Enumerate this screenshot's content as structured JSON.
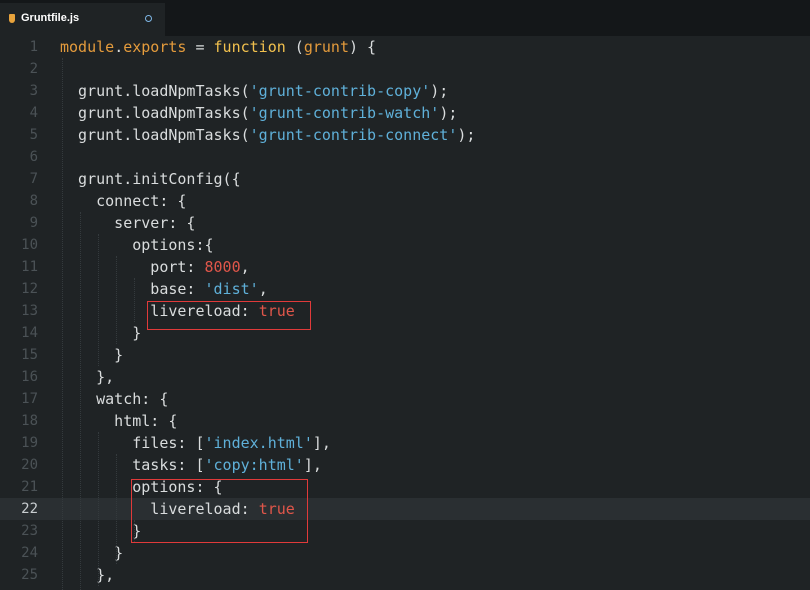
{
  "tab": {
    "title": "Gruntfile.js",
    "file_icon": "grunt-file-icon",
    "status_icon": "unsaved-dot-icon"
  },
  "editor": {
    "current_line": 22,
    "lines": [
      {
        "n": "1",
        "tokens": [
          {
            "t": "module",
            "c": "kw"
          },
          {
            "t": ".",
            "c": "punc"
          },
          {
            "t": "exports",
            "c": "kw"
          },
          {
            "t": " = ",
            "c": "punc"
          },
          {
            "t": "function",
            "c": "fn"
          },
          {
            "t": " (",
            "c": "punc"
          },
          {
            "t": "grunt",
            "c": "kw"
          },
          {
            "t": ") {",
            "c": "punc"
          }
        ]
      },
      {
        "n": "2",
        "tokens": []
      },
      {
        "n": "3",
        "tokens": [
          {
            "t": "  grunt.loadNpmTasks(",
            "c": "plain"
          },
          {
            "t": "'grunt-contrib-copy'",
            "c": "str"
          },
          {
            "t": ");",
            "c": "plain"
          }
        ]
      },
      {
        "n": "4",
        "tokens": [
          {
            "t": "  grunt.loadNpmTasks(",
            "c": "plain"
          },
          {
            "t": "'grunt-contrib-watch'",
            "c": "str"
          },
          {
            "t": ");",
            "c": "plain"
          }
        ]
      },
      {
        "n": "5",
        "tokens": [
          {
            "t": "  grunt.loadNpmTasks(",
            "c": "plain"
          },
          {
            "t": "'grunt-contrib-connect'",
            "c": "str"
          },
          {
            "t": ");",
            "c": "plain"
          }
        ]
      },
      {
        "n": "6",
        "tokens": []
      },
      {
        "n": "7",
        "tokens": [
          {
            "t": "  grunt.initConfig({",
            "c": "plain"
          }
        ]
      },
      {
        "n": "8",
        "tokens": [
          {
            "t": "    connect: {",
            "c": "plain"
          }
        ]
      },
      {
        "n": "9",
        "tokens": [
          {
            "t": "      server: {",
            "c": "plain"
          }
        ]
      },
      {
        "n": "10",
        "tokens": [
          {
            "t": "        options:{",
            "c": "plain"
          }
        ]
      },
      {
        "n": "11",
        "tokens": [
          {
            "t": "          port: ",
            "c": "plain"
          },
          {
            "t": "8000",
            "c": "num"
          },
          {
            "t": ",",
            "c": "plain"
          }
        ]
      },
      {
        "n": "12",
        "tokens": [
          {
            "t": "          base: ",
            "c": "plain"
          },
          {
            "t": "'dist'",
            "c": "str"
          },
          {
            "t": ",",
            "c": "plain"
          }
        ]
      },
      {
        "n": "13",
        "tokens": [
          {
            "t": "          livereload: ",
            "c": "plain"
          },
          {
            "t": "true",
            "c": "bool"
          }
        ]
      },
      {
        "n": "14",
        "tokens": [
          {
            "t": "        }",
            "c": "plain"
          }
        ]
      },
      {
        "n": "15",
        "tokens": [
          {
            "t": "      }",
            "c": "plain"
          }
        ]
      },
      {
        "n": "16",
        "tokens": [
          {
            "t": "    },",
            "c": "plain"
          }
        ]
      },
      {
        "n": "17",
        "tokens": [
          {
            "t": "    watch: {",
            "c": "plain"
          }
        ]
      },
      {
        "n": "18",
        "tokens": [
          {
            "t": "      html: {",
            "c": "plain"
          }
        ]
      },
      {
        "n": "19",
        "tokens": [
          {
            "t": "        files: [",
            "c": "plain"
          },
          {
            "t": "'index.html'",
            "c": "str"
          },
          {
            "t": "],",
            "c": "plain"
          }
        ]
      },
      {
        "n": "20",
        "tokens": [
          {
            "t": "        tasks: [",
            "c": "plain"
          },
          {
            "t": "'copy:html'",
            "c": "str"
          },
          {
            "t": "],",
            "c": "plain"
          }
        ]
      },
      {
        "n": "21",
        "tokens": [
          {
            "t": "        options: {",
            "c": "plain"
          }
        ]
      },
      {
        "n": "22",
        "tokens": [
          {
            "t": "          livereload: ",
            "c": "plain"
          },
          {
            "t": "true",
            "c": "bool"
          }
        ]
      },
      {
        "n": "23",
        "tokens": [
          {
            "t": "        }",
            "c": "plain"
          }
        ]
      },
      {
        "n": "24",
        "tokens": [
          {
            "t": "      }",
            "c": "plain"
          }
        ]
      },
      {
        "n": "25",
        "tokens": [
          {
            "t": "    },",
            "c": "plain"
          }
        ]
      }
    ]
  },
  "colors": {
    "background": "#1f2325",
    "keyword": "#e49b3c",
    "function": "#f2c14e",
    "string": "#5fb0d9",
    "number_bool": "#e0564a",
    "highlight_box": "#e03a3a"
  }
}
